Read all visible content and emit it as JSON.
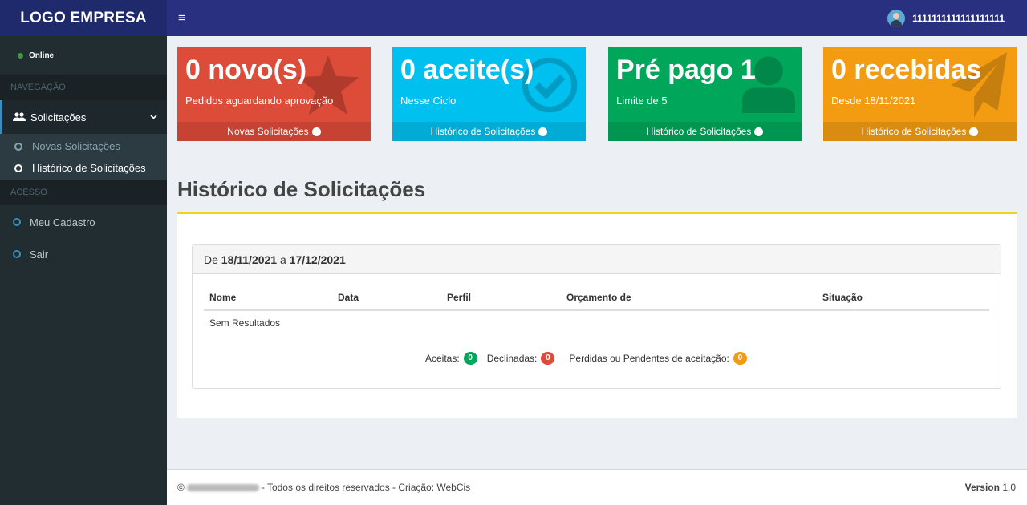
{
  "sidebar": {
    "logo": "LOGO EMPRESA",
    "status": "Online",
    "section_nav": "NAVEGAÇÃO",
    "solicitacoes": "Solicitações",
    "sub_items": [
      "Novas Solicitações",
      "Histórico de Solicitações"
    ],
    "section_access": "ACESSO",
    "meu_cadastro": "Meu Cadastro",
    "sair": "Sair"
  },
  "topbar": {
    "menu_icon": "≡",
    "username": "1111111111111111111"
  },
  "boxes": [
    {
      "value": "0 novo(s)",
      "subtitle": "Pedidos aguardando aprovação",
      "link": "Novas Solicitações",
      "icon": "star-icon",
      "color": "#dd4b39"
    },
    {
      "value": "0 aceite(s)",
      "subtitle": "Nesse Ciclo",
      "link": "Histórico de Solicitações",
      "icon": "check-circle-icon",
      "color": "#00c0ef"
    },
    {
      "value": "Pré pago 1",
      "subtitle": "Limite de 5",
      "link": "Histórico de Solicitações",
      "icon": "user-icon",
      "color": "#00a65a"
    },
    {
      "value": "0 recebidas",
      "subtitle": "Desde 18/11/2021",
      "link": "Histórico de Solicitações",
      "icon": "paper-plane-icon",
      "color": "#f39c12"
    }
  ],
  "main": {
    "title": "Histórico de Solicitações",
    "range_prefix": "De",
    "range_from": "18/11/2021",
    "range_mid": "a",
    "range_to": "17/12/2021",
    "columns": [
      "Nome",
      "Data",
      "Perfil",
      "Orçamento de",
      "Situação"
    ],
    "empty": "Sem Resultados",
    "summary": {
      "aceitas_label": "Aceitas:",
      "aceitas": "0",
      "declinadas_label": "Declinadas:",
      "declinadas": "0",
      "pendentes_label": "Perdidas ou Pendentes de aceitação:",
      "pendentes": "0"
    }
  },
  "footer": {
    "symbol": "©",
    "rights": "- Todos os direitos reservados - Criação: WebCis",
    "version_label": "Version",
    "version": "1.0"
  }
}
